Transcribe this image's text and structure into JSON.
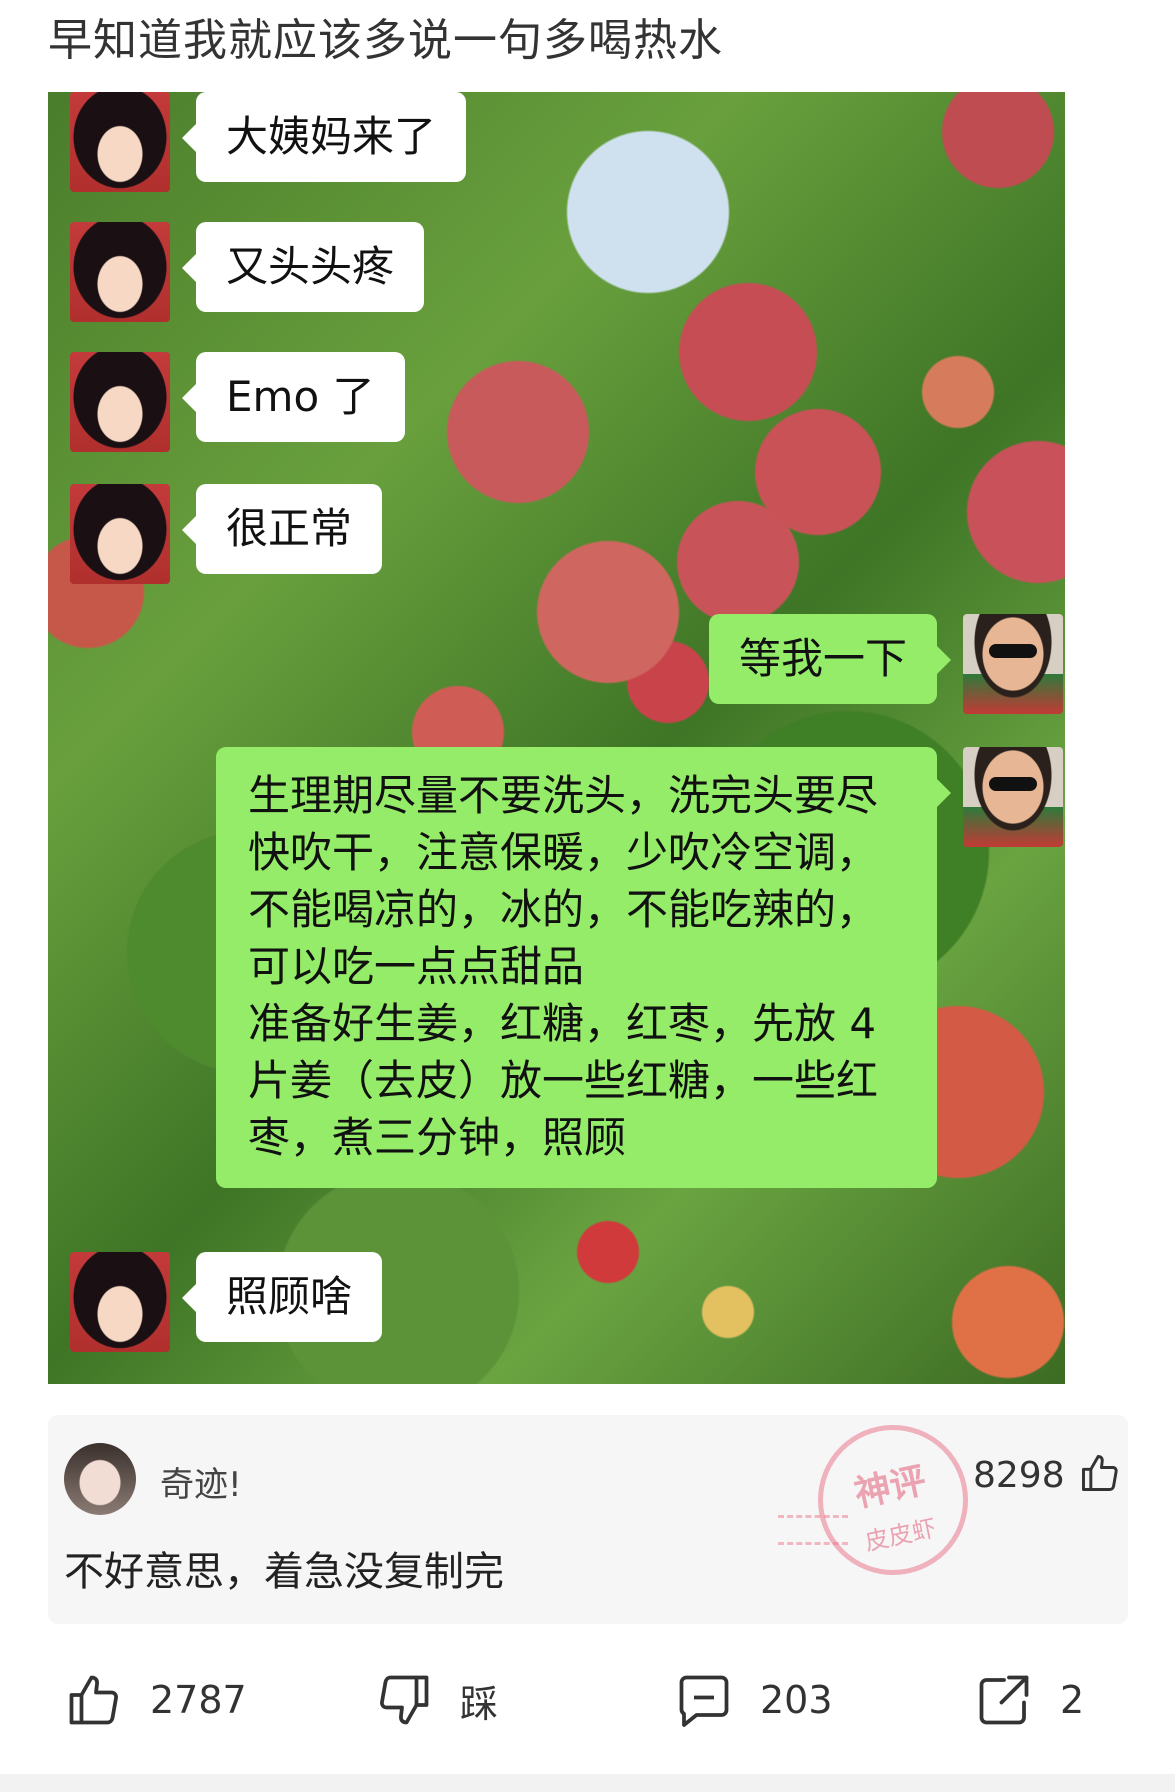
{
  "post": {
    "title": "早知道我就应该多说一句多喝热水"
  },
  "chat": {
    "messages": [
      {
        "side": "left",
        "text": "大姨妈来了"
      },
      {
        "side": "left",
        "text": "又头头疼"
      },
      {
        "side": "left",
        "text": "Emo 了"
      },
      {
        "side": "left",
        "text": "很正常"
      },
      {
        "side": "right",
        "text": "等我一下"
      },
      {
        "side": "right",
        "lines": [
          "生理期尽量不要洗头，洗完头要尽",
          "快吹干，注意保暖，少吹冷空调，",
          "不能喝凉的，冰的，不能吃辣的，",
          "可以吃一点点甜品",
          "准备好生姜，红糖，红枣，先放 4",
          "片姜（去皮）放一些红糖，一些红",
          "枣，煮三分钟，照顾"
        ]
      },
      {
        "side": "left",
        "text": "照顾啥"
      }
    ]
  },
  "comment": {
    "author": "奇迹!",
    "text": "不好意思，着急没复制完",
    "likes": "8298",
    "stamp_top": "神评",
    "stamp_bottom": "皮皮虾"
  },
  "actions": {
    "like_count": "2787",
    "dislike_label": "踩",
    "comment_count": "203",
    "share_count": "2"
  },
  "colors": {
    "bubble_green": "#95ec69",
    "bubble_white": "#ffffff",
    "stamp_pink": "#e15f78"
  }
}
